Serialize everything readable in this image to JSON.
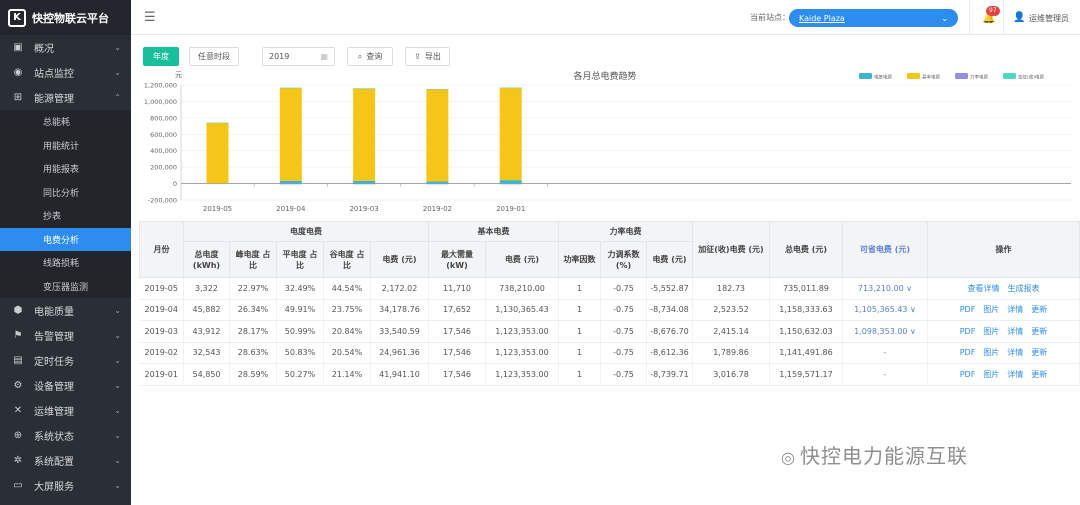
{
  "app": {
    "title": "快控物联云平台",
    "logo_glyph": "K"
  },
  "sidebar": {
    "items": [
      {
        "label": "概况",
        "icon": "dashboard-icon"
      },
      {
        "label": "站点监控",
        "icon": "monitor-icon"
      },
      {
        "label": "能源管理",
        "icon": "energy-icon",
        "expanded": true
      },
      {
        "label": "电能质量",
        "icon": "quality-icon"
      },
      {
        "label": "告警管理",
        "icon": "alarm-icon"
      },
      {
        "label": "定时任务",
        "icon": "timer-icon"
      },
      {
        "label": "设备管理",
        "icon": "device-icon"
      },
      {
        "label": "运维管理",
        "icon": "tools-icon"
      },
      {
        "label": "系统状态",
        "icon": "status-icon"
      },
      {
        "label": "系统配置",
        "icon": "settings-icon"
      },
      {
        "label": "大屏服务",
        "icon": "screen-icon"
      }
    ],
    "sub_items": [
      "总能耗",
      "用能统计",
      "用能报表",
      "同比分析",
      "抄表",
      "电费分析",
      "线路损耗",
      "变压器监测"
    ],
    "active_sub": "电费分析"
  },
  "topbar": {
    "site_label": "当前站点：",
    "site_value": "Kaide Plaza",
    "notification_count": "97",
    "username": "运维管理员"
  },
  "toolbar": {
    "tab_year": "年度",
    "tab_any": "任意时段",
    "year_value": "2019",
    "query_label": "查询",
    "export_label": "导出"
  },
  "chart_data": {
    "type": "bar",
    "title": "各月总电费趋势",
    "ylabel": "元",
    "ylim": [
      -200000,
      1200000
    ],
    "yticks": [
      "1,200,000",
      "1,000,000",
      "800,000",
      "600,000",
      "400,000",
      "200,000",
      "0",
      "-200,000"
    ],
    "categories": [
      "2019-05",
      "2019-04",
      "2019-03",
      "2019-02",
      "2019-01"
    ],
    "series": [
      {
        "name": "电度电费",
        "color": "#3bb7c9",
        "values": [
          2172.02,
          34178.76,
          33540.59,
          24961.36,
          41941.1
        ]
      },
      {
        "name": "基本电费",
        "color": "#f5c518",
        "values": [
          738210,
          1130365.43,
          1123353,
          1123353,
          1123353
        ]
      },
      {
        "name": "力率电费",
        "color": "#8f8fe3",
        "values": [
          -5552.87,
          -8734.08,
          -8676.7,
          -8612.36,
          -8739.71
        ]
      },
      {
        "name": "加征(收)电费",
        "color": "#4fd6c4",
        "values": [
          182.73,
          2523.52,
          2415.14,
          1789.86,
          3016.78
        ]
      }
    ]
  },
  "table": {
    "group_headers": {
      "month": "月份",
      "energy": "电度电费",
      "basic": "基本电费",
      "power_factor": "力率电费",
      "surcharge": "加征(收)电费 (元)",
      "total": "总电费 (元)",
      "saving": "可省电费 (元)",
      "ops": "操作"
    },
    "sub_headers": {
      "total_kwh": "总电度 (kWh)",
      "peak_ratio": "峰电度 占比",
      "flat_ratio": "平电度 占比",
      "valley_ratio": "谷电度 占比",
      "energy_fee": "电费 (元)",
      "max_demand": "最大需量 (kW)",
      "basic_fee": "电费 (元)",
      "pf": "功率因数",
      "pf_adjust": "力调系数 (%)",
      "pf_fee": "电费 (元)"
    },
    "rows": [
      {
        "month": "2019-05",
        "kwh": "3,322",
        "peak": "22.97%",
        "flat": "32.49%",
        "valley": "44.54%",
        "efee": "2,172.02",
        "demand": "11,710",
        "bfee": "738,210.00",
        "pf": "1",
        "adj": "-0.75",
        "pfee": "-5,552.87",
        "sur": "182.73",
        "total": "735,011.89",
        "save": "713,210.00 ∨",
        "ops": [
          "查看详情",
          "生成报表"
        ]
      },
      {
        "month": "2019-04",
        "kwh": "45,882",
        "peak": "26.34%",
        "flat": "49.91%",
        "valley": "23.75%",
        "efee": "34,178.76",
        "demand": "17,652",
        "bfee": "1,130,365.43",
        "pf": "1",
        "adj": "-0.75",
        "pfee": "-8,734.08",
        "sur": "2,523.52",
        "total": "1,158,333.63",
        "save": "1,105,365.43 ∨",
        "ops": [
          "PDF",
          "图片",
          "详情",
          "更新"
        ]
      },
      {
        "month": "2019-03",
        "kwh": "43,912",
        "peak": "28.17%",
        "flat": "50.99%",
        "valley": "20.84%",
        "efee": "33,540.59",
        "demand": "17,546",
        "bfee": "1,123,353.00",
        "pf": "1",
        "adj": "-0.75",
        "pfee": "-8,676.70",
        "sur": "2,415.14",
        "total": "1,150,632.03",
        "save": "1,098,353.00 ∨",
        "ops": [
          "PDF",
          "图片",
          "详情",
          "更新"
        ]
      },
      {
        "month": "2019-02",
        "kwh": "32,543",
        "peak": "28.63%",
        "flat": "50.83%",
        "valley": "20.54%",
        "efee": "24,961.36",
        "demand": "17,546",
        "bfee": "1,123,353.00",
        "pf": "1",
        "adj": "-0.75",
        "pfee": "-8,612.36",
        "sur": "1,789.86",
        "total": "1,141,491.86",
        "save": "-",
        "ops": [
          "PDF",
          "图片",
          "详情",
          "更新"
        ]
      },
      {
        "month": "2019-01",
        "kwh": "54,850",
        "peak": "28.59%",
        "flat": "50.27%",
        "valley": "21.14%",
        "efee": "41,941.10",
        "demand": "17,546",
        "bfee": "1,123,353.00",
        "pf": "1",
        "adj": "-0.75",
        "pfee": "-8,739.71",
        "sur": "3,016.78",
        "total": "1,159,571.17",
        "save": "-",
        "ops": [
          "PDF",
          "图片",
          "详情",
          "更新"
        ]
      }
    ]
  },
  "watermark": "快控电力能源互联"
}
